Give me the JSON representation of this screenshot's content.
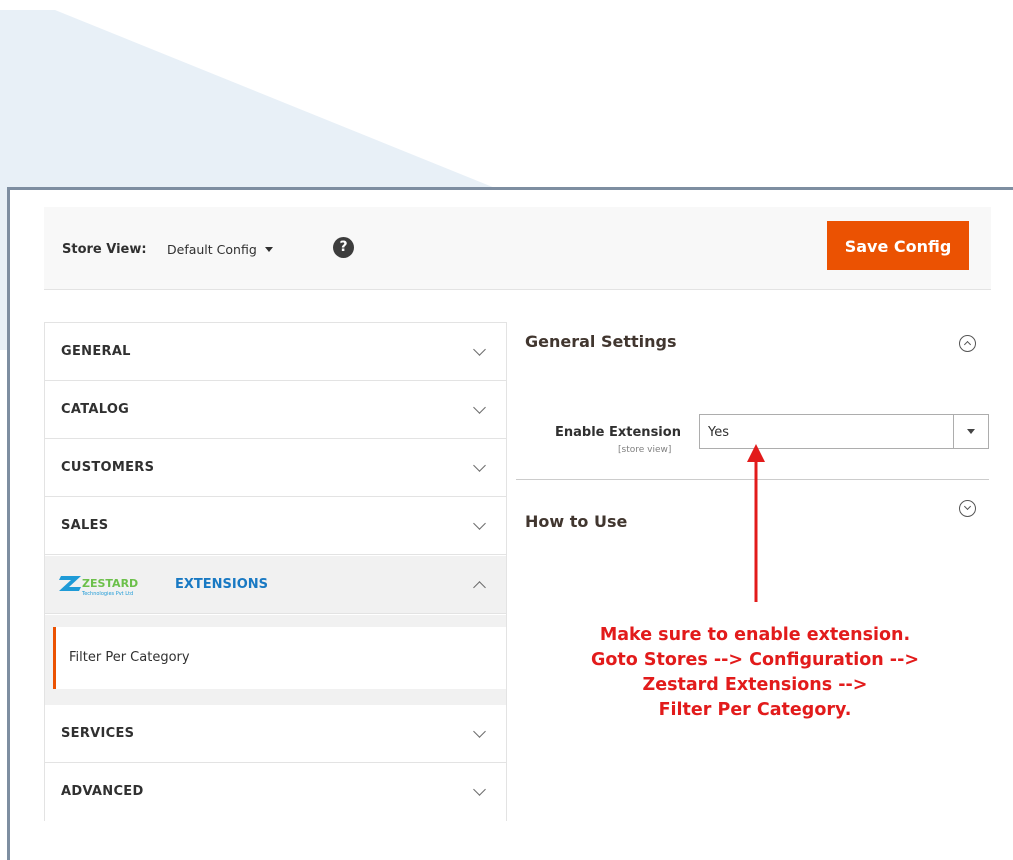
{
  "toolbar": {
    "store_view_label": "Store View:",
    "store_view_value": "Default Config",
    "help_icon": "question-circle-icon",
    "save_label": "Save Config",
    "save_color": "#eb5202"
  },
  "sidebar": {
    "items": [
      {
        "label": "GENERAL",
        "expanded": false
      },
      {
        "label": "CATALOG",
        "expanded": false
      },
      {
        "label": "CUSTOMERS",
        "expanded": false
      },
      {
        "label": "SALES",
        "expanded": false
      },
      {
        "label": "EXTENSIONS",
        "expanded": true,
        "logo_text": "ZESTARD",
        "logo_subtext": "Technologies Pvt Ltd",
        "sub_items": [
          {
            "label": "Filter Per Category",
            "active": true
          }
        ]
      },
      {
        "label": "SERVICES",
        "expanded": false
      },
      {
        "label": "ADVANCED",
        "expanded": false
      }
    ]
  },
  "main": {
    "sections": [
      {
        "title": "General Settings",
        "expanded": true
      },
      {
        "title": "How to Use",
        "expanded": false
      }
    ],
    "field": {
      "label": "Enable Extension",
      "scope": "[store view]",
      "value": "Yes"
    }
  },
  "annotation": {
    "lines": [
      "Make sure to enable extension.",
      "Goto Stores --> Configuration -->",
      "Zestard Extensions -->",
      "Filter Per Category."
    ],
    "color": "#e21b1b"
  }
}
